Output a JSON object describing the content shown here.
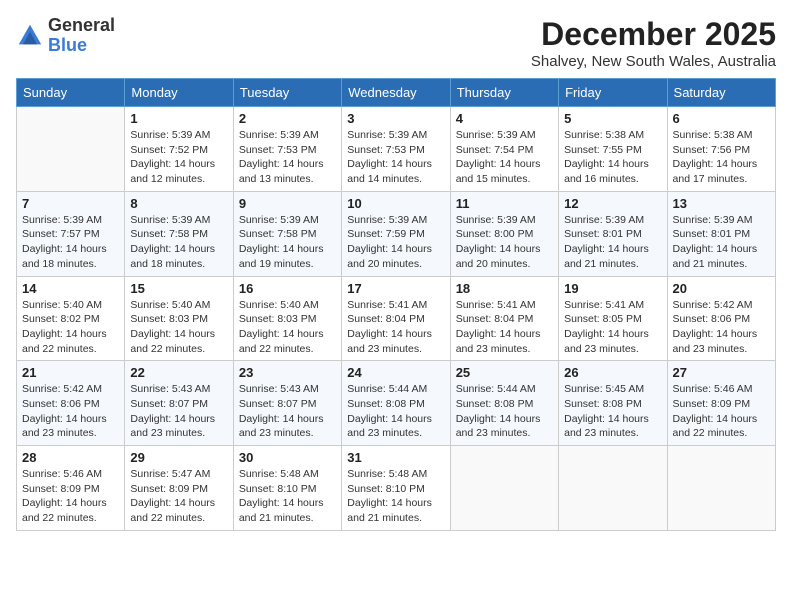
{
  "logo": {
    "general": "General",
    "blue": "Blue"
  },
  "header": {
    "month": "December 2025",
    "location": "Shalvey, New South Wales, Australia"
  },
  "weekdays": [
    "Sunday",
    "Monday",
    "Tuesday",
    "Wednesday",
    "Thursday",
    "Friday",
    "Saturday"
  ],
  "weeks": [
    [
      {
        "day": "",
        "sunrise": "",
        "sunset": "",
        "daylight": ""
      },
      {
        "day": "1",
        "sunrise": "Sunrise: 5:39 AM",
        "sunset": "Sunset: 7:52 PM",
        "daylight": "Daylight: 14 hours and 12 minutes."
      },
      {
        "day": "2",
        "sunrise": "Sunrise: 5:39 AM",
        "sunset": "Sunset: 7:53 PM",
        "daylight": "Daylight: 14 hours and 13 minutes."
      },
      {
        "day": "3",
        "sunrise": "Sunrise: 5:39 AM",
        "sunset": "Sunset: 7:53 PM",
        "daylight": "Daylight: 14 hours and 14 minutes."
      },
      {
        "day": "4",
        "sunrise": "Sunrise: 5:39 AM",
        "sunset": "Sunset: 7:54 PM",
        "daylight": "Daylight: 14 hours and 15 minutes."
      },
      {
        "day": "5",
        "sunrise": "Sunrise: 5:38 AM",
        "sunset": "Sunset: 7:55 PM",
        "daylight": "Daylight: 14 hours and 16 minutes."
      },
      {
        "day": "6",
        "sunrise": "Sunrise: 5:38 AM",
        "sunset": "Sunset: 7:56 PM",
        "daylight": "Daylight: 14 hours and 17 minutes."
      }
    ],
    [
      {
        "day": "7",
        "sunrise": "Sunrise: 5:39 AM",
        "sunset": "Sunset: 7:57 PM",
        "daylight": "Daylight: 14 hours and 18 minutes."
      },
      {
        "day": "8",
        "sunrise": "Sunrise: 5:39 AM",
        "sunset": "Sunset: 7:58 PM",
        "daylight": "Daylight: 14 hours and 18 minutes."
      },
      {
        "day": "9",
        "sunrise": "Sunrise: 5:39 AM",
        "sunset": "Sunset: 7:58 PM",
        "daylight": "Daylight: 14 hours and 19 minutes."
      },
      {
        "day": "10",
        "sunrise": "Sunrise: 5:39 AM",
        "sunset": "Sunset: 7:59 PM",
        "daylight": "Daylight: 14 hours and 20 minutes."
      },
      {
        "day": "11",
        "sunrise": "Sunrise: 5:39 AM",
        "sunset": "Sunset: 8:00 PM",
        "daylight": "Daylight: 14 hours and 20 minutes."
      },
      {
        "day": "12",
        "sunrise": "Sunrise: 5:39 AM",
        "sunset": "Sunset: 8:01 PM",
        "daylight": "Daylight: 14 hours and 21 minutes."
      },
      {
        "day": "13",
        "sunrise": "Sunrise: 5:39 AM",
        "sunset": "Sunset: 8:01 PM",
        "daylight": "Daylight: 14 hours and 21 minutes."
      }
    ],
    [
      {
        "day": "14",
        "sunrise": "Sunrise: 5:40 AM",
        "sunset": "Sunset: 8:02 PM",
        "daylight": "Daylight: 14 hours and 22 minutes."
      },
      {
        "day": "15",
        "sunrise": "Sunrise: 5:40 AM",
        "sunset": "Sunset: 8:03 PM",
        "daylight": "Daylight: 14 hours and 22 minutes."
      },
      {
        "day": "16",
        "sunrise": "Sunrise: 5:40 AM",
        "sunset": "Sunset: 8:03 PM",
        "daylight": "Daylight: 14 hours and 22 minutes."
      },
      {
        "day": "17",
        "sunrise": "Sunrise: 5:41 AM",
        "sunset": "Sunset: 8:04 PM",
        "daylight": "Daylight: 14 hours and 23 minutes."
      },
      {
        "day": "18",
        "sunrise": "Sunrise: 5:41 AM",
        "sunset": "Sunset: 8:04 PM",
        "daylight": "Daylight: 14 hours and 23 minutes."
      },
      {
        "day": "19",
        "sunrise": "Sunrise: 5:41 AM",
        "sunset": "Sunset: 8:05 PM",
        "daylight": "Daylight: 14 hours and 23 minutes."
      },
      {
        "day": "20",
        "sunrise": "Sunrise: 5:42 AM",
        "sunset": "Sunset: 8:06 PM",
        "daylight": "Daylight: 14 hours and 23 minutes."
      }
    ],
    [
      {
        "day": "21",
        "sunrise": "Sunrise: 5:42 AM",
        "sunset": "Sunset: 8:06 PM",
        "daylight": "Daylight: 14 hours and 23 minutes."
      },
      {
        "day": "22",
        "sunrise": "Sunrise: 5:43 AM",
        "sunset": "Sunset: 8:07 PM",
        "daylight": "Daylight: 14 hours and 23 minutes."
      },
      {
        "day": "23",
        "sunrise": "Sunrise: 5:43 AM",
        "sunset": "Sunset: 8:07 PM",
        "daylight": "Daylight: 14 hours and 23 minutes."
      },
      {
        "day": "24",
        "sunrise": "Sunrise: 5:44 AM",
        "sunset": "Sunset: 8:08 PM",
        "daylight": "Daylight: 14 hours and 23 minutes."
      },
      {
        "day": "25",
        "sunrise": "Sunrise: 5:44 AM",
        "sunset": "Sunset: 8:08 PM",
        "daylight": "Daylight: 14 hours and 23 minutes."
      },
      {
        "day": "26",
        "sunrise": "Sunrise: 5:45 AM",
        "sunset": "Sunset: 8:08 PM",
        "daylight": "Daylight: 14 hours and 23 minutes."
      },
      {
        "day": "27",
        "sunrise": "Sunrise: 5:46 AM",
        "sunset": "Sunset: 8:09 PM",
        "daylight": "Daylight: 14 hours and 22 minutes."
      }
    ],
    [
      {
        "day": "28",
        "sunrise": "Sunrise: 5:46 AM",
        "sunset": "Sunset: 8:09 PM",
        "daylight": "Daylight: 14 hours and 22 minutes."
      },
      {
        "day": "29",
        "sunrise": "Sunrise: 5:47 AM",
        "sunset": "Sunset: 8:09 PM",
        "daylight": "Daylight: 14 hours and 22 minutes."
      },
      {
        "day": "30",
        "sunrise": "Sunrise: 5:48 AM",
        "sunset": "Sunset: 8:10 PM",
        "daylight": "Daylight: 14 hours and 21 minutes."
      },
      {
        "day": "31",
        "sunrise": "Sunrise: 5:48 AM",
        "sunset": "Sunset: 8:10 PM",
        "daylight": "Daylight: 14 hours and 21 minutes."
      },
      {
        "day": "",
        "sunrise": "",
        "sunset": "",
        "daylight": ""
      },
      {
        "day": "",
        "sunrise": "",
        "sunset": "",
        "daylight": ""
      },
      {
        "day": "",
        "sunrise": "",
        "sunset": "",
        "daylight": ""
      }
    ]
  ]
}
